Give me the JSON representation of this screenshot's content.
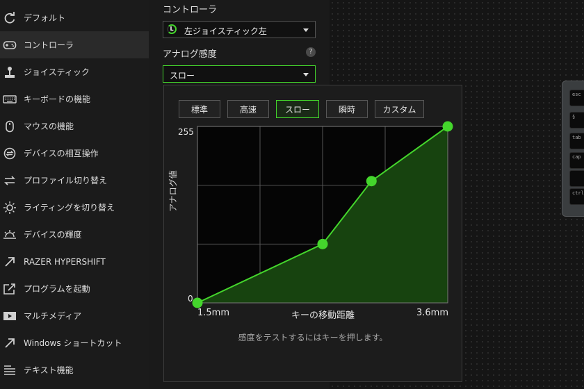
{
  "sidebar": {
    "items": [
      {
        "label": "デフォルト",
        "icon": "refresh-icon",
        "active": false
      },
      {
        "label": "コントローラ",
        "icon": "gamepad-icon",
        "active": true
      },
      {
        "label": "ジョイスティック",
        "icon": "joystick-icon",
        "active": false
      },
      {
        "label": "キーボードの機能",
        "icon": "keyboard-icon",
        "active": false
      },
      {
        "label": "マウスの機能",
        "icon": "mouse-icon",
        "active": false
      },
      {
        "label": "デバイスの相互操作",
        "icon": "device-interaction-icon",
        "active": false
      },
      {
        "label": "プロファイル切り替え",
        "icon": "profile-switch-icon",
        "active": false
      },
      {
        "label": "ライティングを切り替え",
        "icon": "lighting-icon",
        "active": false
      },
      {
        "label": "デバイスの輝度",
        "icon": "brightness-icon",
        "active": false
      },
      {
        "label": "RAZER HYPERSHIFT",
        "icon": "hypershift-arrow-icon",
        "active": false
      },
      {
        "label": "プログラムを起動",
        "icon": "launch-program-icon",
        "active": false
      },
      {
        "label": "マルチメディア",
        "icon": "multimedia-play-icon",
        "active": false
      },
      {
        "label": "Windows ショートカット",
        "icon": "shortcut-arrow-icon",
        "active": false
      },
      {
        "label": "テキスト機能",
        "icon": "text-function-icon",
        "active": false
      }
    ]
  },
  "controller": {
    "section_label": "コントローラ",
    "stick_badge": "L",
    "selected": "左ジョイスティック左"
  },
  "sensitivity": {
    "section_label": "アナログ感度",
    "help": "?",
    "selected": "スロー"
  },
  "popup": {
    "presets": [
      "標準",
      "高速",
      "スロー",
      "瞬時",
      "カスタム"
    ],
    "selected_preset": "スロー",
    "hint": "感度をテストするにはキーを押します。"
  },
  "device_keys": [
    "esc",
    "§",
    "tab",
    "cap",
    "",
    "ctrl"
  ],
  "colors": {
    "accent": "#44d62c",
    "fill": "#17430f",
    "grid": "#555555"
  },
  "chart_data": {
    "type": "area",
    "xlabel": "キーの移動距離",
    "ylabel": "アナログ値",
    "x_tick_labels": [
      "1.5mm",
      "3.6mm"
    ],
    "y_tick_labels": [
      "255",
      "0"
    ],
    "x_range": [
      1.5,
      3.6
    ],
    "ylim": [
      0,
      255
    ],
    "grid": true,
    "points": [
      {
        "x": 1.5,
        "y": 0
      },
      {
        "x": 2.55,
        "y": 85
      },
      {
        "x": 2.96,
        "y": 176
      },
      {
        "x": 3.6,
        "y": 255
      }
    ]
  }
}
